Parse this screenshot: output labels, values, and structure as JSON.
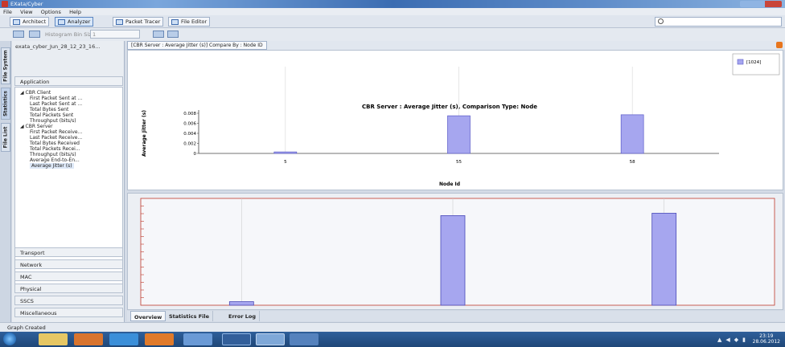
{
  "window": {
    "title": "EXata/Cyber"
  },
  "menu": [
    "File",
    "View",
    "Options",
    "Help"
  ],
  "toolbar": {
    "architect": "Architect",
    "analyzer": "Analyzer",
    "packet_tracer": "Packet Tracer",
    "file_editor": "File Editor"
  },
  "toolbar2": {
    "histogram_label": "Histogram Bin Size",
    "histogram_value": "1"
  },
  "vertical_tabs": [
    "File System",
    "Statistics",
    "File List"
  ],
  "left_panel": {
    "scenario": "exata_cyber_Jun_28_12_23_16...",
    "application": "Application",
    "tree": [
      {
        "label": "CBR Client",
        "children": [
          "First Packet Sent at ...",
          "Last Packet Sent at ...",
          "Total Bytes Sent",
          "Total Packets Sent",
          "Throughput (bits/s)"
        ]
      },
      {
        "label": "CBR Server",
        "children": [
          "First Packet Receive...",
          "Last Packet Receive...",
          "Total Bytes Received",
          "Total Packets Recei...",
          "Throughput (bits/s)",
          "Average End-to-En...",
          "Average Jitter (s)"
        ]
      }
    ],
    "sections": [
      "Transport",
      "Network",
      "MAC",
      "Physical",
      "SSCS",
      "Miscellaneous"
    ]
  },
  "chart_tab": "[CBR Server : Average Jitter (s)] Compare By : Node ID",
  "chart_data": {
    "type": "bar",
    "title": "CBR Server :  Average Jitter (s), Comparison Type: Node",
    "xlabel": "Node Id",
    "ylabel": "Average Jitter (s)",
    "categories": [
      "5",
      "55",
      "58"
    ],
    "series": [
      {
        "name": "[1024]",
        "values": [
          0.0003,
          0.0075,
          0.0077
        ]
      }
    ],
    "yticks": [
      "0",
      "0.002",
      "0.004",
      "0.006",
      "0.008"
    ],
    "ylim": [
      0,
      0.008
    ],
    "legend": "top-right",
    "color": "#a6a6ef",
    "grid": true
  },
  "bottom_tabs": [
    "Overview",
    "Statistics File",
    "Error Log"
  ],
  "status": "Graph Created",
  "taskbar": {
    "time": "23:19",
    "date": "28.06.2012",
    "pinned": [
      "explorer",
      "media-player",
      "internet-explorer",
      "firefox",
      "dell",
      "app",
      "exata",
      "app2"
    ]
  }
}
